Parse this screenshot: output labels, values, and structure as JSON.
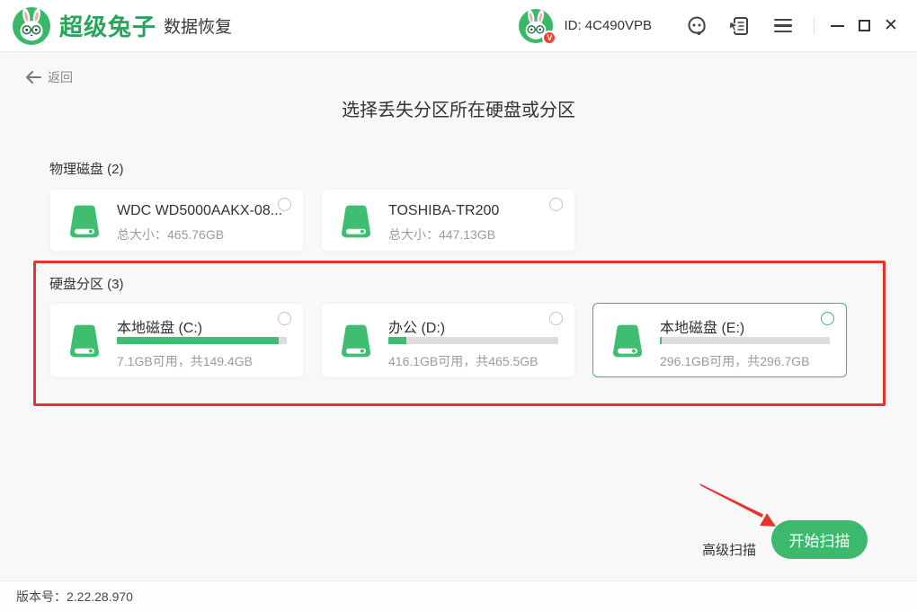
{
  "header": {
    "brand": "超级兔子",
    "product": "数据恢复",
    "user_id": "ID: 4C490VPB",
    "badge": "V",
    "icons": {
      "logo": "rabbit-logo",
      "avatar": "rabbit-avatar",
      "support": "headset-support",
      "feedback": "feedback-survey",
      "menu": "hamburger-menu",
      "minimize": "minimize",
      "maximize": "maximize",
      "close": "close"
    }
  },
  "nav": {
    "back": "返回",
    "back_icon": "arrow-left"
  },
  "page": {
    "title": "选择丢失分区所在硬盘或分区"
  },
  "physical_disks": {
    "label": "物理磁盘 (2)",
    "cards": [
      {
        "name": "WDC WD5000AAKX-08...",
        "info": "总大小：465.76GB",
        "selected": false
      },
      {
        "name": "TOSHIBA-TR200",
        "info": "总大小：447.13GB",
        "selected": false
      }
    ]
  },
  "partitions": {
    "label": "硬盘分区 (3)",
    "cards": [
      {
        "name": "本地磁盘 (C:)",
        "info": "7.1GB可用，共149.4GB",
        "used_percent": 95.2,
        "selected": false
      },
      {
        "name": "办公 (D:)",
        "info": "416.1GB可用，共465.5GB",
        "used_percent": 10.6,
        "selected": false
      },
      {
        "name": "本地磁盘 (E:)",
        "info": "296.1GB可用，共296.7GB",
        "used_percent": 1.2,
        "selected": true
      }
    ]
  },
  "actions": {
    "advanced": "高级扫描",
    "start": "开始扫描"
  },
  "footer": {
    "version": "版本号：2.22.28.970"
  },
  "colors": {
    "accent_green": "#3cb96d",
    "icon_green": "#3fbe71",
    "brand_green": "#2aa35b",
    "annotation_red": "#e5352b",
    "badge_red": "#f4432c"
  },
  "annotations": {
    "highlight_box": "partition-section-highlight",
    "pointer": "arrow-to-start-button"
  }
}
